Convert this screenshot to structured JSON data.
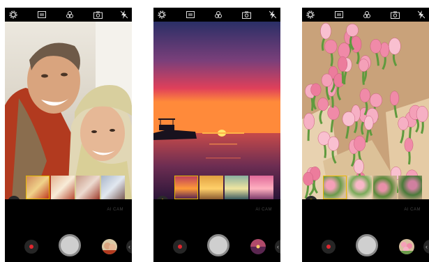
{
  "phones": [
    {
      "scene": "couple",
      "filter_count": 4,
      "ai_label": "AI CAM",
      "topbar_icons": [
        "settings-icon",
        "menu-icon",
        "mode-icon",
        "switch-camera-icon",
        "flash-off-icon"
      ],
      "bottom": {
        "record": "record-button",
        "shutter": "shutter-button",
        "gallery": "gallery-thumbnail",
        "expand": "‹"
      }
    },
    {
      "scene": "sunset",
      "filter_count": 4,
      "ai_label": "AI CAM",
      "topbar_icons": [
        "settings-icon",
        "menu-icon",
        "mode-icon",
        "switch-camera-icon",
        "flash-off-icon"
      ],
      "bottom": {
        "record": "record-button",
        "shutter": "shutter-button",
        "gallery": "gallery-thumbnail",
        "expand": "‹"
      }
    },
    {
      "scene": "tulips",
      "filter_count": 4,
      "ai_label": "AI CAM",
      "topbar_icons": [
        "settings-icon",
        "menu-icon",
        "mode-icon",
        "switch-camera-icon",
        "flash-off-icon"
      ],
      "bottom": {
        "record": "record-button",
        "shutter": "shutter-button",
        "gallery": "gallery-thumbnail",
        "expand": "‹"
      }
    }
  ],
  "colors": {
    "accent": "#e6b800",
    "record": "#e0262f",
    "background": "#000000"
  }
}
